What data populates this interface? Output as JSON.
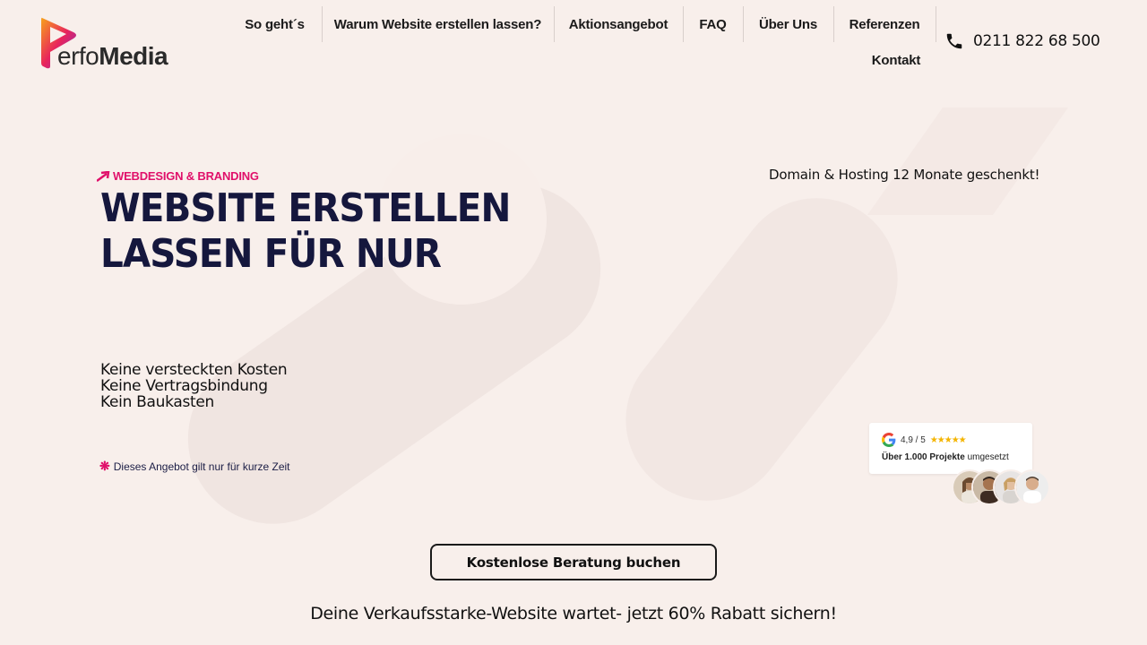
{
  "brand": {
    "logo_part1": "erfo",
    "logo_part2": "Media"
  },
  "nav": {
    "items": [
      "So geht´s",
      "Warum Website erstellen lassen?",
      "Aktionsangebot",
      "FAQ",
      "Über Uns",
      "Referenzen",
      "Kontakt"
    ]
  },
  "contact": {
    "phone": "0211 822 68 500",
    "icon": "phone-icon"
  },
  "hero": {
    "eyebrow": "WEBDESIGN & BRANDING",
    "headline_line1": "WEBSITE ERSTELLEN",
    "headline_line2": "LASSEN FÜR NUR",
    "domain_note": "Domain & Hosting 12 Monate geschenkt!",
    "bullets": [
      "Keine versteckten Kosten",
      "Keine Vertragsbindung",
      "Kein Baukasten"
    ],
    "offer_note": "Dieses Angebot gilt nur für kurze Zeit"
  },
  "rating": {
    "score": "4,9 / 5",
    "stars": "★★★★★",
    "rating_value": 4.9,
    "projects_bold": "Über 1.000 Projekte",
    "projects_rest": " umgesetzt"
  },
  "cta": {
    "label": "Kostenlose Beratung buchen"
  },
  "promo": {
    "text": "Deine Verkaufsstarke-Website wartet- jetzt 60% Rabatt sichern!"
  },
  "colors": {
    "background": "#f8efeb",
    "accent": "#e0106a",
    "headline": "#15173d",
    "star": "#f4b400"
  }
}
